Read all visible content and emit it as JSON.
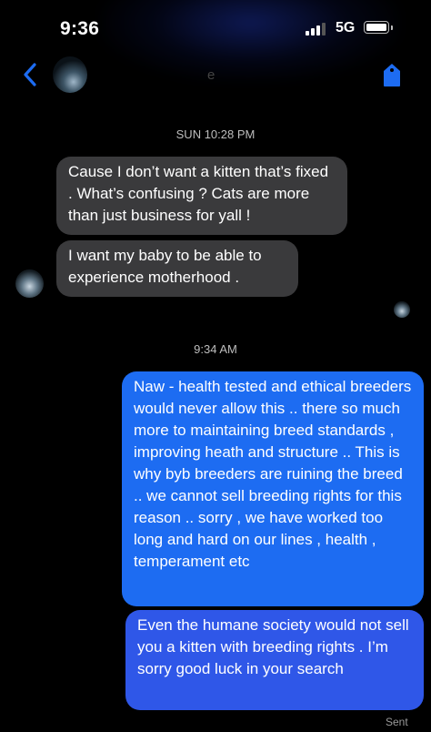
{
  "status_bar": {
    "time": "9:36",
    "network": "5G",
    "signal_bars_active": 3,
    "battery_level": 1.0
  },
  "nav": {
    "back_icon": "chevron-left-icon",
    "contact_name": "e",
    "action_icon": "tag-icon",
    "accent_color": "#1d6cf2"
  },
  "messages": {
    "timestamp_1": "SUN 10:28 PM",
    "received_1": "Cause I don’t want a kitten that’s fixed . What’s confusing ? Cats are more than just business for yall !",
    "received_2": "I want my baby to be able to experience motherhood .",
    "timestamp_2": "9:34 AM",
    "sent_1": "Naw - health tested and ethical breeders would never allow this .. there so much more to maintaining breed standards , improving heath and structure ..  This is why byb breeders are ruining the breed .. we cannot sell breeding  rights for this reason .. sorry , we have worked too long and hard on our lines , health , temperament etc",
    "sent_2": "Even the humane society would not sell you a kitten with breeding rights .  I’m sorry good luck in your search",
    "delivery_status": "Sent"
  }
}
